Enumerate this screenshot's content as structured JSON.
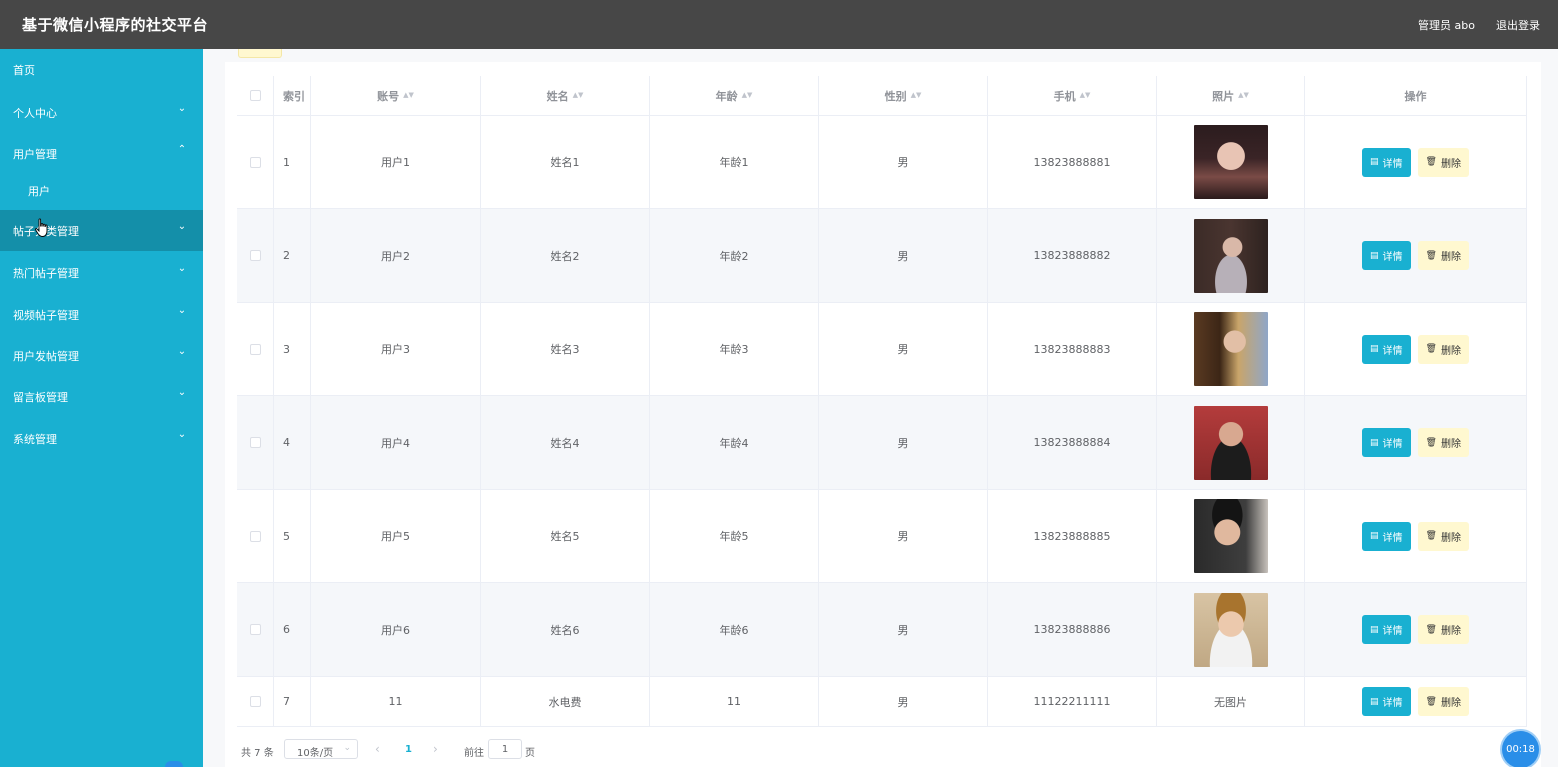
{
  "header": {
    "title": "基于微信小程序的社交平台",
    "user": "管理员 abo",
    "logout": "退出登录"
  },
  "sidebar": {
    "items": [
      {
        "label": "首页",
        "chevron": ""
      },
      {
        "label": "个人中心",
        "chevron": "⌄"
      },
      {
        "label": "用户管理",
        "chevron": "⌃"
      },
      {
        "label": "用户",
        "chevron": ""
      },
      {
        "label": "帖子分类管理",
        "chevron": "⌄"
      },
      {
        "label": "热门帖子管理",
        "chevron": "⌄"
      },
      {
        "label": "视频帖子管理",
        "chevron": "⌄"
      },
      {
        "label": "用户发帖管理",
        "chevron": "⌄"
      },
      {
        "label": "留言板管理",
        "chevron": "⌄"
      },
      {
        "label": "系统管理",
        "chevron": "⌄"
      }
    ]
  },
  "table": {
    "columns": [
      "索引",
      "账号",
      "姓名",
      "年龄",
      "性别",
      "手机",
      "照片",
      "操作"
    ],
    "sort_icon": "▲▼",
    "rows": [
      {
        "index": "1",
        "account": "用户1",
        "name": "姓名1",
        "age": "年龄1",
        "gender": "男",
        "phone": "13823888881",
        "photo": ""
      },
      {
        "index": "2",
        "account": "用户2",
        "name": "姓名2",
        "age": "年龄2",
        "gender": "男",
        "phone": "13823888882",
        "photo": ""
      },
      {
        "index": "3",
        "account": "用户3",
        "name": "姓名3",
        "age": "年龄3",
        "gender": "男",
        "phone": "13823888883",
        "photo": ""
      },
      {
        "index": "4",
        "account": "用户4",
        "name": "姓名4",
        "age": "年龄4",
        "gender": "男",
        "phone": "13823888884",
        "photo": ""
      },
      {
        "index": "5",
        "account": "用户5",
        "name": "姓名5",
        "age": "年龄5",
        "gender": "男",
        "phone": "13823888885",
        "photo": ""
      },
      {
        "index": "6",
        "account": "用户6",
        "name": "姓名6",
        "age": "年龄6",
        "gender": "男",
        "phone": "13823888886",
        "photo": ""
      },
      {
        "index": "7",
        "account": "11",
        "name": "水电费",
        "age": "11",
        "gender": "男",
        "phone": "11122211111",
        "photo": "无图片"
      }
    ],
    "actions": {
      "detail": "详情",
      "delete": "删除",
      "detail_icon": "▤",
      "delete_icon": "🗑"
    }
  },
  "pagination": {
    "total": "共 7 条",
    "page_size": "10条/页",
    "current_page": "1",
    "goto_label": "前往",
    "goto_value": "1",
    "page_suffix": "页",
    "prev_icon": "‹",
    "next_icon": "›",
    "dropdown_icon": "⌄"
  },
  "timer": "00:18",
  "colors": {
    "topbar": "#474747",
    "sidebar": "#19b0d1",
    "sidebar_active": "#148fa9",
    "detail_button": "#19b0d1",
    "delete_button": "#fff8d0",
    "timer": "#2a8ee8"
  }
}
